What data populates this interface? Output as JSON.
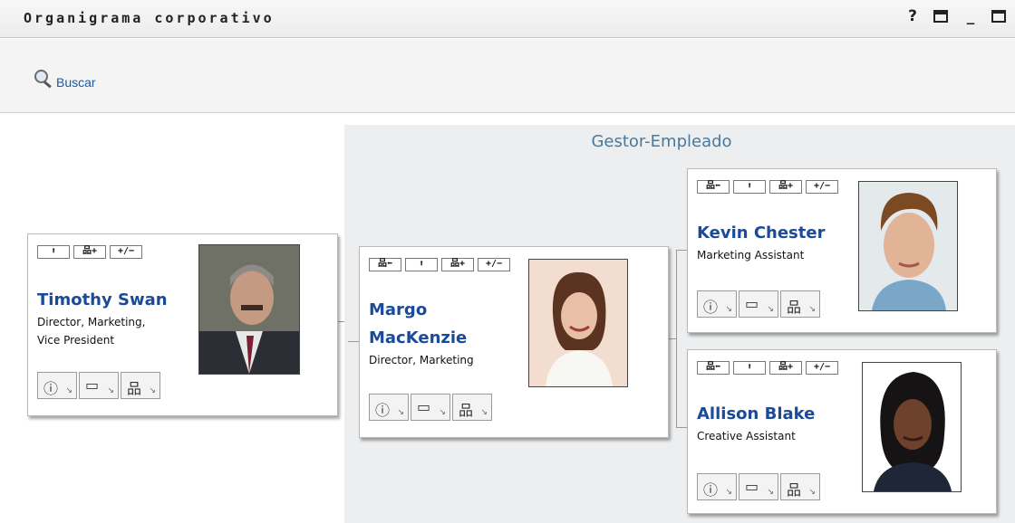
{
  "window": {
    "title": "Organigrama corporativo",
    "help_icon": "help-icon",
    "print_icon": "printer-icon",
    "minimize_icon": "minimize-icon",
    "maximize_icon": "maximize-icon",
    "help_glyph": "?",
    "minimize_glyph": "_"
  },
  "search": {
    "label": "Buscar",
    "icon": "magnifier-icon"
  },
  "panel": {
    "title": "Gestor-Empleado"
  },
  "toolbar_labels": {
    "parent": "⬆",
    "children": "品+",
    "toggle": "+/−",
    "back": "品⬅"
  },
  "action_labels": {
    "info": "ⓘ",
    "email": "▭",
    "org": "品",
    "arrow": "↘"
  },
  "people": {
    "timothy": {
      "name": "Timothy Swan",
      "title_line1": "Director, Marketing,",
      "title_line2": "Vice President"
    },
    "margo": {
      "name_line1": "Margo",
      "name_line2": "MacKenzie",
      "title": "Director, Marketing"
    },
    "kevin": {
      "name": "Kevin Chester",
      "title": "Marketing Assistant"
    },
    "allison": {
      "name": "Allison Blake",
      "title": "Creative Assistant"
    }
  },
  "colors": {
    "name_blue": "#1a4a9a",
    "panel_bg": "#eceeef",
    "panel_title": "#4a7a9b",
    "link": "#1a5aa8"
  }
}
